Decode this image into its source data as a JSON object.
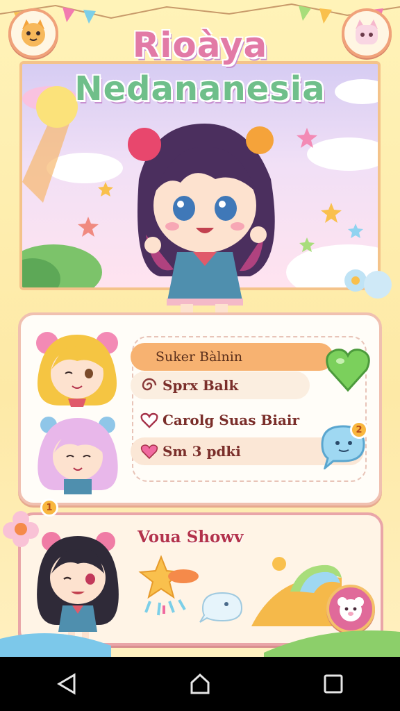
{
  "header": {
    "title_line1": "Rioàya",
    "title_line2": "Nedananesia",
    "left_button_icon": "cat-face-icon",
    "right_button_icon": "cat-face-icon"
  },
  "menu": {
    "items": [
      {
        "label": "Suker Bàlnin",
        "icon": ""
      },
      {
        "label": "Sprx Balk",
        "icon": "swirl-icon"
      },
      {
        "label": "Carolg Suas Biair",
        "icon": "heart-outline-icon"
      },
      {
        "label": "Sm 3 pdki",
        "icon": "heart-icon"
      }
    ],
    "chat_badge": "2",
    "heart_button_icon": "heart-icon"
  },
  "bottom": {
    "title": "Voua Showv",
    "badge": "1",
    "action_icon": "bear-face-icon"
  },
  "colors": {
    "accent_pink": "#e27aa6",
    "accent_green": "#6fbf8a",
    "panel_border": "#f0c0b0",
    "row_highlight": "#f7b271"
  }
}
